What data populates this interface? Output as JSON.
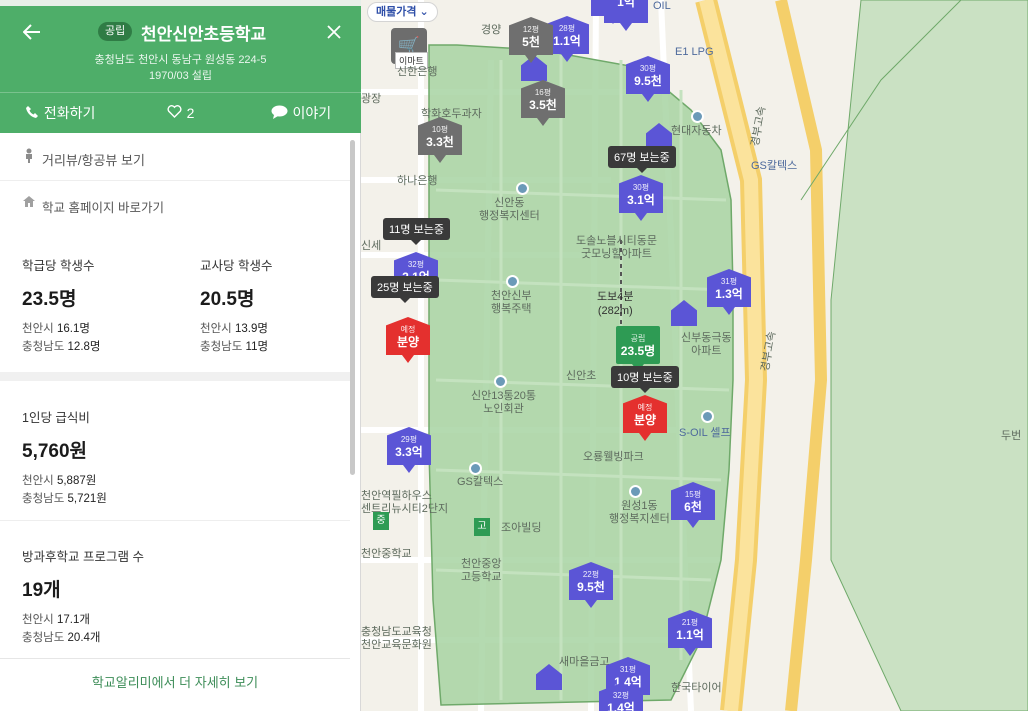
{
  "panel": {
    "back_icon": "arrow-left-icon",
    "badge": "공립",
    "school_name": "천안신안초등학교",
    "close_icon": "close-icon",
    "address": "충청남도 천안시 동남구 원성동 224-5",
    "established": "1970/03 설립",
    "actions": {
      "call": "전화하기",
      "like_count": "2",
      "talk": "이야기"
    },
    "street_view": "거리뷰/항공뷰 보기",
    "homepage": "학교 홈페이지 바로가기",
    "stats": {
      "per_class": {
        "title": "학급당 학생수",
        "value": "23.5명",
        "city_label": "천안시",
        "city_value": "16.1명",
        "prov_label": "충청남도",
        "prov_value": "12.8명"
      },
      "per_teacher": {
        "title": "교사당 학생수",
        "value": "20.5명",
        "city_label": "천안시",
        "city_value": "13.9명",
        "prov_label": "충청남도",
        "prov_value": "11명"
      },
      "meal_cost": {
        "title": "1인당 급식비",
        "value": "5,760원",
        "city_label": "천안시",
        "city_value": "5,887원",
        "prov_label": "충청남도",
        "prov_value": "5,721원"
      },
      "after_school": {
        "title": "방과후학교 프로그램 수",
        "value": "19개",
        "city_label": "천안시",
        "city_value": "17.1개",
        "prov_label": "충청남도",
        "prov_value": "20.4개"
      }
    },
    "more_link": "학교알리미에서 더 자세히 보기"
  },
  "map": {
    "filter_label": "매물가격",
    "mart_label": "이마트",
    "colors": {
      "zone_fill": "#a7d3a2",
      "road": "#f7d67a",
      "pin_blue": "#5b55d6",
      "pin_gray": "#6f6f6f",
      "pin_red": "#e4302e",
      "school": "#2e9b54"
    },
    "places": {
      "shinhan": "신한은행",
      "hana": "하나은행",
      "hodu": "학화호두과자",
      "sinan_center": "신안동\n행정복지센터",
      "dosol": "도솔노블시티동문\n굿모닝힐아파트",
      "sinbu": "천안신부\n행복주택",
      "noin": "신안13통20통\n노인회관",
      "sinancho": "신안초",
      "orong": "오룡웰빙파크",
      "soil": "S-OIL 셀프",
      "gs1": "GS칼텍스",
      "gs2": "GS칼텍스",
      "wonseong": "원성1동\n행정복지센터",
      "joa": "조아빌딩",
      "jungang": "천안중앙\n고등학교",
      "hyundai": "현대자동차",
      "sinbudong": "신부동극동\n아파트",
      "e1": "E1 LPG",
      "oil": "OIL",
      "saemaeul": "새마을금고",
      "hankook": "한국타이어",
      "yeokpil": "천안역필하우스\n센트리뉴시티2단지",
      "jung": "천안중학교",
      "edu": "충청남도교육청\n천안교육문화원",
      "gyeongbu": "경부고속",
      "gyeongbu2": "경부고속",
      "dubeon": "두번",
      "kyeongin": "경양",
      "gwangjang": "광장",
      "sinsegye": "신세"
    },
    "walk": {
      "time": "도보4분",
      "distance": "(282m)"
    },
    "tooltips": [
      "67명 보는중",
      "11명 보는중",
      "25명 보는중",
      "10명 보는중"
    ],
    "pins": [
      {
        "size": "28평",
        "price": "1.1억",
        "kind": "blue"
      },
      {
        "size": "12평",
        "price": "5천",
        "kind": "gray"
      },
      {
        "size": "",
        "price": "3.3억",
        "kind": "blue"
      },
      {
        "size": "",
        "price": "1억",
        "kind": "blue"
      },
      {
        "size": "30평",
        "price": "9.5천",
        "kind": "blue"
      },
      {
        "size": "16평",
        "price": "3.5천",
        "kind": "gray"
      },
      {
        "size": "10평",
        "price": "3.3천",
        "kind": "gray"
      },
      {
        "size": "30평",
        "price": "3.1억",
        "kind": "blue"
      },
      {
        "size": "32평",
        "price": "2.1억",
        "kind": "blue"
      },
      {
        "size": "31평",
        "price": "1.3억",
        "kind": "blue"
      },
      {
        "size": "예정",
        "price": "분양",
        "kind": "red"
      },
      {
        "size": "공립",
        "price": "23.5명",
        "kind": "green"
      },
      {
        "size": "예정",
        "price": "분양",
        "kind": "red"
      },
      {
        "size": "29평",
        "price": "3.3억",
        "kind": "blue"
      },
      {
        "size": "15평",
        "price": "6천",
        "kind": "blue"
      },
      {
        "size": "22평",
        "price": "9.5천",
        "kind": "blue"
      },
      {
        "size": "21평",
        "price": "1.1억",
        "kind": "blue"
      },
      {
        "size": "31평",
        "price": "1.4억",
        "kind": "blue"
      },
      {
        "size": "32평",
        "price": "1.4억",
        "kind": "blue"
      }
    ],
    "school_flags": [
      "중",
      "고"
    ]
  }
}
